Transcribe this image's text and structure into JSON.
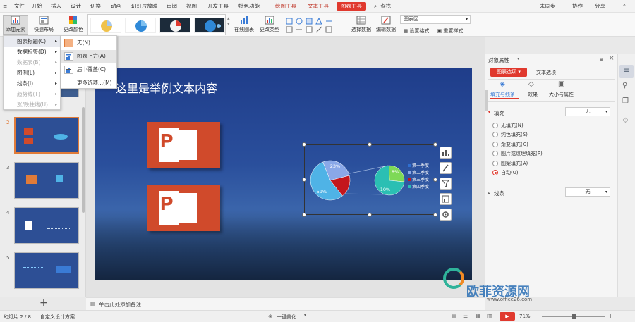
{
  "menubar": {
    "tabs": [
      "文件",
      "开始",
      "插入",
      "设计",
      "切换",
      "动画",
      "幻灯片放映",
      "审阅",
      "视图",
      "开发工具",
      "特色功能",
      "绘图工具",
      "文本工具",
      "图表工具"
    ],
    "search": "查找",
    "right": [
      "未同步",
      "协作",
      "分享"
    ]
  },
  "ribbon": {
    "add_element": "添加元素",
    "quick_layout": "快速布局",
    "change_color": "更改颜色",
    "online_chart": "在线图表",
    "change_type": "更改类型",
    "select_data": "选择数据",
    "edit_data": "编辑数据",
    "set_format": "设置格式",
    "reset_style": "重置样式",
    "chart_area": "图表区"
  },
  "dropdown": {
    "items": [
      {
        "label": "图表标题(C)",
        "disabled": false
      },
      {
        "label": "数据标签(D)",
        "disabled": false
      },
      {
        "label": "数据表(B)",
        "disabled": true
      },
      {
        "label": "图例(L)",
        "disabled": false
      },
      {
        "label": "线条(I)",
        "disabled": false
      },
      {
        "label": "趋势线(T)",
        "disabled": true
      },
      {
        "label": "涨/跌柱线(U)",
        "disabled": true
      }
    ]
  },
  "submenu": {
    "items": [
      "无(N)",
      "图表上方(A)",
      "居中覆盖(C)",
      "更多选项...(M)"
    ]
  },
  "slides": {
    "numbers": [
      "2",
      "3",
      "4",
      "5"
    ]
  },
  "slide": {
    "title": "这里是举例文本内容"
  },
  "chart_data": {
    "type": "pie",
    "legend": [
      "第一季度",
      "第二季度",
      "第三季度",
      "第四季度"
    ],
    "primary_labels": [
      "23%",
      "59%"
    ],
    "secondary_labels": [
      "8%",
      "10%"
    ],
    "colors": [
      "#2f6fd1",
      "#8aa8e8",
      "#c4161c",
      "#4fb3e6",
      "#2bbfb3",
      "#7ed957"
    ]
  },
  "rightpanel": {
    "title": "对象属性",
    "tab_chart_options": "图表选项",
    "tab_text_options": "文本选项",
    "sub_fill_line": "填充与线条",
    "sub_effect": "效果",
    "sub_size_prop": "大小与属性",
    "fill_section": "填充",
    "fill_value": "无",
    "options": [
      "无填充(N)",
      "纯色填充(S)",
      "渐变填充(G)",
      "图片或纹理填充(P)",
      "图案填充(A)",
      "自动(U)"
    ],
    "line_section": "线条",
    "line_value": "无"
  },
  "notes": "单击此处添加备注",
  "status": {
    "slide_no": "幻灯片 2 / 8",
    "theme": "自定义设计方案",
    "beautify": "一键美化",
    "zoom": "71%"
  },
  "watermark": {
    "title": "欧菲资源网",
    "url": "www.office26.com"
  }
}
